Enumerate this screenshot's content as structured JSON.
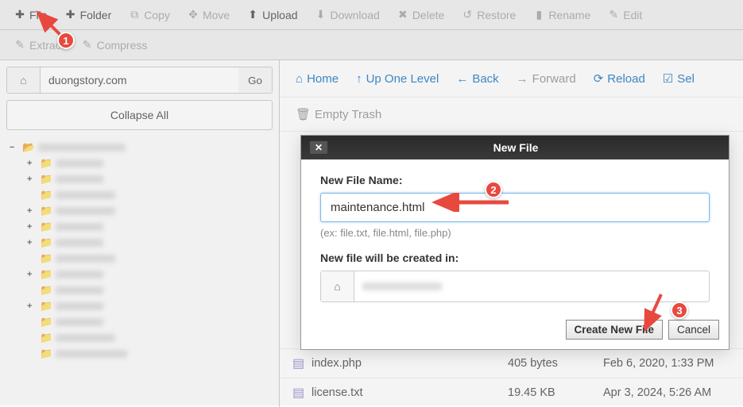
{
  "toolbar": {
    "file": "File",
    "folder": "Folder",
    "copy": "Copy",
    "move": "Move",
    "upload": "Upload",
    "download": "Download",
    "delete": "Delete",
    "restore": "Restore",
    "rename": "Rename",
    "edit": "Edit",
    "extract": "Extract",
    "compress": "Compress"
  },
  "address": {
    "domain": "duongstory.com",
    "go": "Go",
    "collapse_all": "Collapse All"
  },
  "right_nav": {
    "home": "Home",
    "up": "Up One Level",
    "back": "Back",
    "forward": "Forward",
    "reload": "Reload",
    "select_all": "Sel",
    "empty_trash": "Empty Trash"
  },
  "modal": {
    "title": "New File",
    "label_name": "New File Name:",
    "input_value": "maintenance.html",
    "hint": "(ex: file.txt, file.html, file.php)",
    "label_path": "New file will be created in:",
    "create": "Create New File",
    "cancel": "Cancel"
  },
  "files": [
    {
      "name": "index.php",
      "size": "405 bytes",
      "date": "Feb 6, 2020, 1:33 PM"
    },
    {
      "name": "license.txt",
      "size": "19.45 KB",
      "date": "Apr 3, 2024, 5:26 AM"
    }
  ],
  "annotations": {
    "step1": "1",
    "step2": "2",
    "step3": "3"
  }
}
